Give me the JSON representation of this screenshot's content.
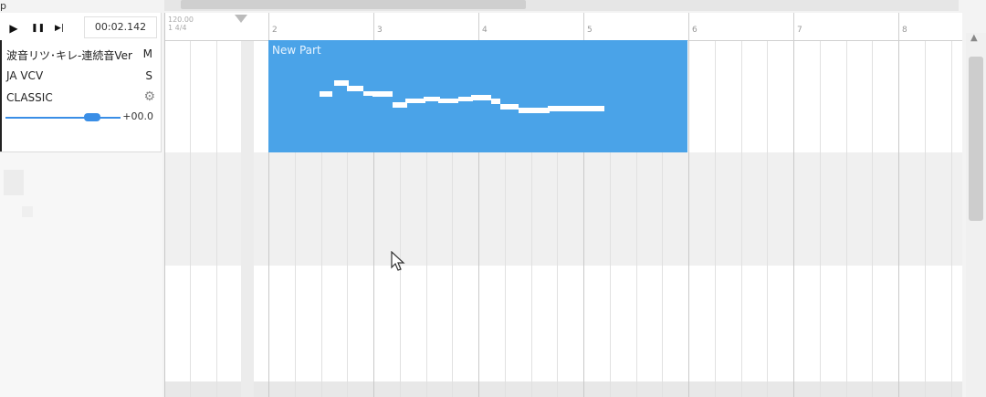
{
  "menu_stub": "p",
  "transport": {
    "play_icon": "play-icon",
    "pause_icon": "pause-icon",
    "stop_icon": "step-icon",
    "play_glyph": "▶",
    "pause_glyph": "❚❚",
    "stop_glyph": "▶|",
    "time": "00:02.142"
  },
  "track": {
    "singer": "波音リツ･キレ-連続音Ver",
    "mute_label": "M",
    "phonemizer": "JA VCV",
    "solo_label": "S",
    "renderer": "CLASSIC",
    "settings_icon": "gear-icon",
    "gear_glyph": "⚙",
    "volume": "+00.0"
  },
  "ruler": {
    "tempo_line1": "120.00",
    "tempo_line2": "1  4/4",
    "bars": [
      "2",
      "3",
      "4",
      "5",
      "6",
      "7",
      "8"
    ]
  },
  "part": {
    "name": "New Part",
    "color": "#4aa3e8",
    "note_color": "#ffffff"
  },
  "scroll": {
    "up_glyph": "▲"
  }
}
